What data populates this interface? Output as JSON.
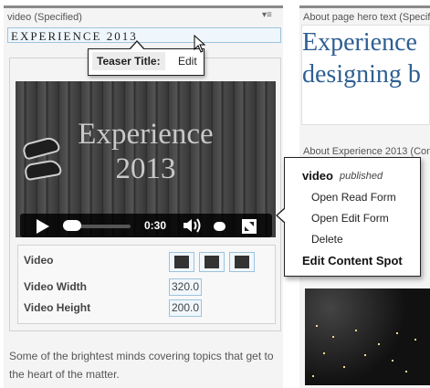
{
  "left_panel": {
    "header": "video (Specified)",
    "menu_icon": "menu-sort-icon",
    "teaser_value": "EXPERIENCE 2013",
    "teaser_tooltip": {
      "label": "Teaser Title:",
      "action": "Edit"
    },
    "video": {
      "overlay_title_line1": "Experience",
      "overlay_title_line2": "2013",
      "time": "0:30",
      "progress": 0.06
    },
    "properties": {
      "video_label": "Video",
      "width_label": "Video Width",
      "width_value": "320.0",
      "height_label": "Video Height",
      "height_value": "200.0"
    },
    "description": "Some of the brightest minds covering topics that get to the heart of the matter."
  },
  "right_panel": {
    "hero_label": "About page hero text (Specif",
    "hero_line1": "Experience",
    "hero_line2": "designing b",
    "about_label": "About Experience 2013 (Con"
  },
  "context_menu": {
    "title": "video",
    "status": "published",
    "items": [
      "Open Read Form",
      "Open Edit Form",
      "Delete"
    ],
    "bold_item": "Edit Content Spot"
  }
}
